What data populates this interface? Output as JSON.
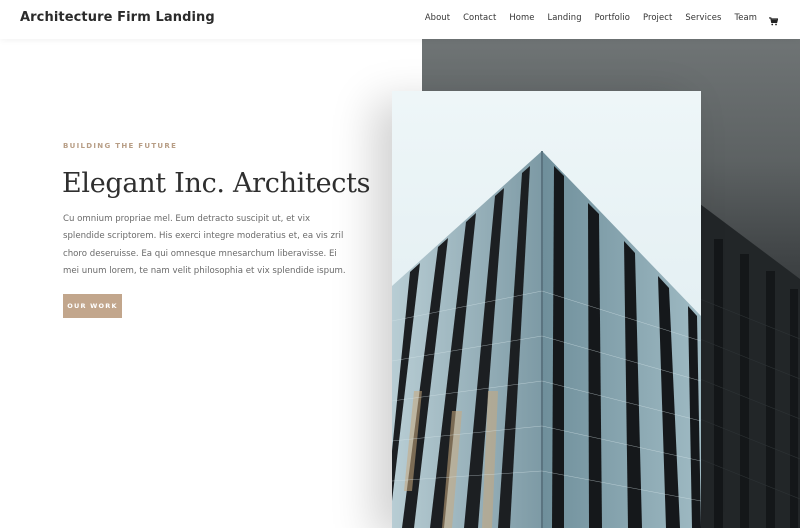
{
  "header": {
    "brand": "Architecture Firm Landing",
    "nav": [
      {
        "label": "About"
      },
      {
        "label": "Contact"
      },
      {
        "label": "Home"
      },
      {
        "label": "Landing"
      },
      {
        "label": "Portfolio"
      },
      {
        "label": "Project"
      },
      {
        "label": "Services"
      },
      {
        "label": "Team"
      }
    ],
    "cart_icon": "shopping-cart-icon"
  },
  "hero": {
    "eyebrow": "BUILDING THE FUTURE",
    "title": "Elegant Inc. Architects",
    "body": "Cu omnium propriae mel. Eum detracto suscipit ut, et vix splendide scriptorem. His exerci integre moderatius et, ea vis zril choro deseruisse. Ea qui omnesque mnesarchum liberavisse. Ei mei unum lorem, te nam velit philosophia et vix splendide ispum.",
    "button_label": "OUR WORK",
    "image_subject": "glass skyscraper viewed from below"
  },
  "colors": {
    "accent": "#c2a68c",
    "eyebrow": "#b89e86",
    "heading": "#2f2f2f",
    "body_text": "#6a6a6a"
  }
}
